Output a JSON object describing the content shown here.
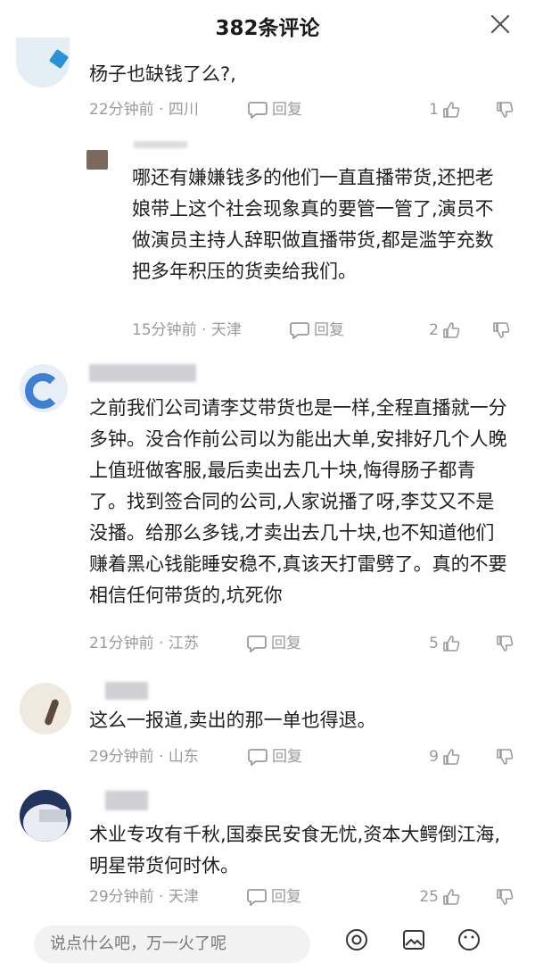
{
  "header": {
    "title": "382条评论"
  },
  "comments": [
    {
      "text": "杨子也缺钱了么?,",
      "time": "22分钟前 · 四川",
      "reply": "回复",
      "likes": "1"
    },
    {
      "text": "哪还有嫌嫌钱多的他们一直直播带货,还把老娘带上这个社会现象真的要管一管了,演员不做演员主持人辞职做直播带货,都是滥竽充数把多年积压的货卖给我们。",
      "time": "15分钟前 · 天津",
      "reply": "回复",
      "likes": "2"
    },
    {
      "text": "之前我们公司请李艾带货也是一样,全程直播就一分多钟。没合作前公司以为能出大单,安排好几个人晚上值班做客服,最后卖出去几十块,悔得肠子都青了。找到签合同的公司,人家说播了呀,李艾又不是没播。给那么多钱,才卖出去几十块,也不知道他们赚着黑心钱能睡安稳不,真该天打雷劈了。真的不要相信任何带货的,坑死你",
      "time": "21分钟前 · 江苏",
      "reply": "回复",
      "likes": "5"
    },
    {
      "text": "这么一报道,卖出的那一单也得退。",
      "time": "29分钟前 · 山东",
      "reply": "回复",
      "likes": "9"
    },
    {
      "text": "术业专攻有千秋,国泰民安食无忧,资本大鳄倒江海,明星带货何时休。",
      "time": "29分钟前 · 天津",
      "reply": "回复",
      "likes": "25"
    }
  ],
  "bottom": {
    "placeholder": "说点什么吧，万一火了呢"
  },
  "colors": {
    "meta": "#9a9a9a",
    "text": "#1f1f1f"
  }
}
